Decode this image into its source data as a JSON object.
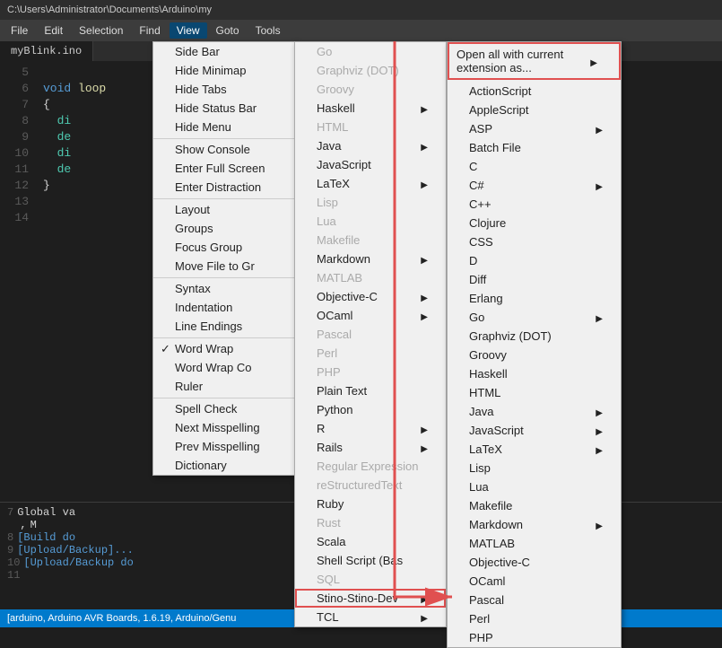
{
  "titleBar": {
    "text": "C:\\Users\\Administrator\\Documents\\Arduino\\my"
  },
  "menuBar": {
    "items": [
      "File",
      "Edit",
      "Selection",
      "Find",
      "View",
      "Goto",
      "Tools"
    ]
  },
  "tab": {
    "label": "myBlink.ino"
  },
  "editor": {
    "lines": [
      {
        "num": "5",
        "code": ""
      },
      {
        "num": "6",
        "code": "void loop"
      },
      {
        "num": "7",
        "code": "{"
      },
      {
        "num": "8",
        "code": "  di"
      },
      {
        "num": "9",
        "code": "  de"
      },
      {
        "num": "10",
        "code": "  di"
      },
      {
        "num": "11",
        "code": "  de"
      },
      {
        "num": "12",
        "code": "}"
      },
      {
        "num": "13",
        "code": ""
      },
      {
        "num": "14",
        "code": ""
      }
    ]
  },
  "bottomPanel": {
    "lines": [
      {
        "num": "7",
        "text": "Global va"
      },
      {
        "num": "",
        "text": ", "
      },
      {
        "num": "",
        "text": "M"
      },
      {
        "num": "8",
        "text": "[Build do"
      },
      {
        "num": "9",
        "text": "[Upload/Backup]..."
      },
      {
        "num": "10",
        "text": "[Upload/Backup do"
      },
      {
        "num": "11",
        "text": ""
      }
    ]
  },
  "statusBar": {
    "text": "[arduino, Arduino AVR Boards, 1.6.19, Arduino/Genu"
  },
  "viewMenu": {
    "items": [
      {
        "label": "Side Bar",
        "type": "normal"
      },
      {
        "label": "Hide Minimap",
        "type": "normal"
      },
      {
        "label": "Hide Tabs",
        "type": "normal"
      },
      {
        "label": "Hide Status Bar",
        "type": "normal"
      },
      {
        "label": "Hide Menu",
        "type": "normal"
      },
      {
        "label": "Show Console",
        "type": "normal",
        "separator": true
      },
      {
        "label": "Enter Full Screen",
        "type": "normal"
      },
      {
        "label": "Enter Distraction",
        "type": "normal",
        "separator": true
      },
      {
        "label": "Layout",
        "type": "normal"
      },
      {
        "label": "Groups",
        "type": "normal"
      },
      {
        "label": "Focus Group",
        "type": "normal"
      },
      {
        "label": "Move File to Gr",
        "type": "normal",
        "separator": true
      },
      {
        "label": "Syntax",
        "type": "normal"
      },
      {
        "label": "Indentation",
        "type": "normal"
      },
      {
        "label": "Line Endings",
        "type": "normal",
        "separator": true
      },
      {
        "label": "Word Wrap",
        "type": "checked"
      },
      {
        "label": "Word Wrap Co",
        "type": "normal"
      },
      {
        "label": "Ruler",
        "type": "normal",
        "separator": true
      },
      {
        "label": "Spell Check",
        "type": "normal"
      },
      {
        "label": "Next Misspelling",
        "type": "normal"
      },
      {
        "label": "Prev Misspelling",
        "type": "normal"
      },
      {
        "label": "Dictionary",
        "type": "normal"
      }
    ]
  },
  "gotoLabel": "Goto Tools",
  "syntaxMenu": {
    "items": [
      {
        "label": "Go",
        "type": "disabled"
      },
      {
        "label": "Graphviz (DOT)",
        "type": "disabled"
      },
      {
        "label": "Groovy",
        "type": "disabled"
      },
      {
        "label": "Haskell",
        "type": "submenu"
      },
      {
        "label": "HTML",
        "type": "disabled"
      },
      {
        "label": "Java",
        "type": "submenu"
      },
      {
        "label": "JavaScript",
        "type": "normal"
      },
      {
        "label": "LaTeX",
        "type": "submenu"
      },
      {
        "label": "Lisp",
        "type": "disabled"
      },
      {
        "label": "Lua",
        "type": "disabled"
      },
      {
        "label": "Makefile",
        "type": "disabled"
      },
      {
        "label": "Markdown",
        "type": "submenu"
      },
      {
        "label": "MATLAB",
        "type": "disabled"
      },
      {
        "label": "Objective-C",
        "type": "submenu"
      },
      {
        "label": "OCaml",
        "type": "submenu"
      },
      {
        "label": "Pascal",
        "type": "disabled"
      },
      {
        "label": "Perl",
        "type": "disabled"
      },
      {
        "label": "PHP",
        "type": "disabled"
      },
      {
        "label": "Plain Text",
        "type": "normal"
      },
      {
        "label": "Python",
        "type": "normal"
      },
      {
        "label": "R",
        "type": "submenu"
      },
      {
        "label": "Rails",
        "type": "submenu"
      },
      {
        "label": "Regular Expression",
        "type": "disabled"
      },
      {
        "label": "reStructuredText",
        "type": "disabled"
      },
      {
        "label": "Ruby",
        "type": "normal"
      },
      {
        "label": "Rust",
        "type": "disabled"
      },
      {
        "label": "Scala",
        "type": "normal"
      },
      {
        "label": "Shell Script (Bas",
        "type": "normal"
      },
      {
        "label": "SQL",
        "type": "disabled"
      },
      {
        "label": "Stino-Stino-Dev",
        "type": "submenu",
        "highlighted": true
      },
      {
        "label": "TCL",
        "type": "submenu"
      }
    ]
  },
  "extensionMenu": {
    "openAllLabel": "Open all with current extension as...",
    "items": [
      {
        "label": "ActionScript",
        "type": "normal"
      },
      {
        "label": "AppleScript",
        "type": "normal"
      },
      {
        "label": "ASP",
        "type": "submenu"
      },
      {
        "label": "Batch File",
        "type": "normal"
      },
      {
        "label": "C",
        "type": "normal"
      },
      {
        "label": "C#",
        "type": "submenu"
      },
      {
        "label": "C++",
        "type": "normal"
      },
      {
        "label": "Clojure",
        "type": "normal"
      },
      {
        "label": "CSS",
        "type": "normal"
      },
      {
        "label": "D",
        "type": "normal"
      },
      {
        "label": "Diff",
        "type": "normal"
      },
      {
        "label": "Erlang",
        "type": "normal"
      },
      {
        "label": "Go",
        "type": "submenu"
      },
      {
        "label": "Graphviz (DOT)",
        "type": "normal"
      },
      {
        "label": "Groovy",
        "type": "normal"
      },
      {
        "label": "Haskell",
        "type": "normal"
      },
      {
        "label": "HTML",
        "type": "normal"
      },
      {
        "label": "Java",
        "type": "submenu"
      },
      {
        "label": "JavaScript",
        "type": "submenu"
      },
      {
        "label": "LaTeX",
        "type": "submenu"
      },
      {
        "label": "Lisp",
        "type": "normal"
      },
      {
        "label": "Lua",
        "type": "normal"
      },
      {
        "label": "Makefile",
        "type": "normal"
      },
      {
        "label": "Markdown",
        "type": "submenu"
      },
      {
        "label": "MATLAB",
        "type": "normal"
      },
      {
        "label": "Objective-C",
        "type": "normal"
      },
      {
        "label": "OCaml",
        "type": "normal"
      },
      {
        "label": "Pascal",
        "type": "normal"
      },
      {
        "label": "Perl",
        "type": "normal"
      },
      {
        "label": "PHP",
        "type": "normal"
      }
    ]
  }
}
